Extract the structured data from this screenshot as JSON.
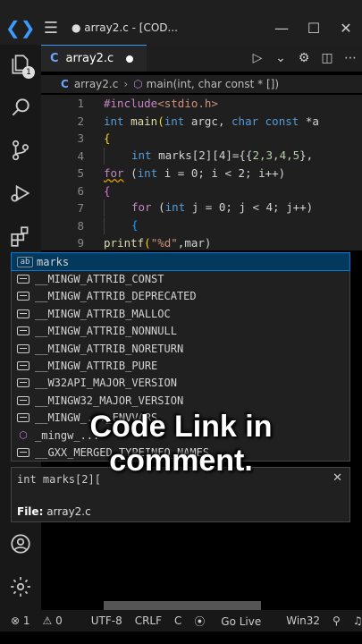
{
  "titlebar": {
    "title": "● array2.c - [COD...",
    "menu_icon": "hamburger-icon",
    "minimize": "—",
    "maximize": "☐",
    "close": "✕"
  },
  "tab": {
    "lang": "C",
    "filename": "array2.c"
  },
  "breadcrumb": {
    "lang": "C",
    "file": "array2.c",
    "function": "main(int, char const * [])"
  },
  "editor": {
    "lines": [
      {
        "n": "1"
      },
      {
        "n": "2"
      },
      {
        "n": "3"
      },
      {
        "n": "4"
      },
      {
        "n": "5"
      },
      {
        "n": "6"
      },
      {
        "n": "7"
      },
      {
        "n": "8"
      },
      {
        "n": "9"
      }
    ],
    "line1": {
      "pp": "#include",
      "inc": "<stdio.h>"
    },
    "line2": {
      "kw1": "int",
      "fn": "main",
      "a1": "(",
      "kw2": "int",
      "argc": " argc, ",
      "kw3": "char",
      "kw4": "const",
      "rest": " *a"
    },
    "line3": {
      "brace": "{"
    },
    "line4": {
      "kw": "int",
      "text": " marks[2][4]={{",
      "nums": "2,3,4,5",
      "rest": "},"
    },
    "line5": {
      "kw1": "for",
      "a": " (",
      "kw2": "int",
      "rest": " i = 0; i < 2; i++)"
    },
    "line6": {
      "brace": "{"
    },
    "line7": {
      "kw1": "for",
      "a": " (",
      "kw2": "int",
      "rest": " j = 0; j < 4; j++)"
    },
    "line8": {
      "brace": "{"
    },
    "line9": {
      "fn": "printf",
      "p": "(",
      "str": "\"%d\"",
      "rest": ",mar)"
    }
  },
  "suggestions": [
    {
      "icon": "abc",
      "label": "marks",
      "selected": true
    },
    {
      "icon": "macro",
      "label": "__MINGW_ATTRIB_CONST"
    },
    {
      "icon": "macro",
      "label": "__MINGW_ATTRIB_DEPRECATED"
    },
    {
      "icon": "macro",
      "label": "__MINGW_ATTRIB_MALLOC"
    },
    {
      "icon": "macro",
      "label": "__MINGW_ATTRIB_NONNULL"
    },
    {
      "icon": "macro",
      "label": "__MINGW_ATTRIB_NORETURN"
    },
    {
      "icon": "macro",
      "label": "__MINGW_ATTRIB_PURE"
    },
    {
      "icon": "macro",
      "label": "__W32API_MAJOR_VERSION"
    },
    {
      "icon": "macro",
      "label": "__MINGW32_MAJOR_VERSION"
    },
    {
      "icon": "macro",
      "label": "__MINGW_..._ENVVARS"
    },
    {
      "icon": "cube",
      "label": "_mingw_..."
    },
    {
      "icon": "macro",
      "label": "__GXX_MERGED_TYPEINFO_NAMES"
    }
  ],
  "detail": {
    "signature": "int marks[2][",
    "close": "✕",
    "file_label": "File:",
    "file_value": "array2.c"
  },
  "statusbar": {
    "errors": "⊗ 1",
    "warnings": "⚠ 0",
    "encoding": "UTF-8",
    "eol": "CRLF",
    "lang": "C",
    "golive": "Go Live",
    "platform": "Win32"
  },
  "caption": {
    "line1": "Code Link in",
    "line2": "comment."
  }
}
